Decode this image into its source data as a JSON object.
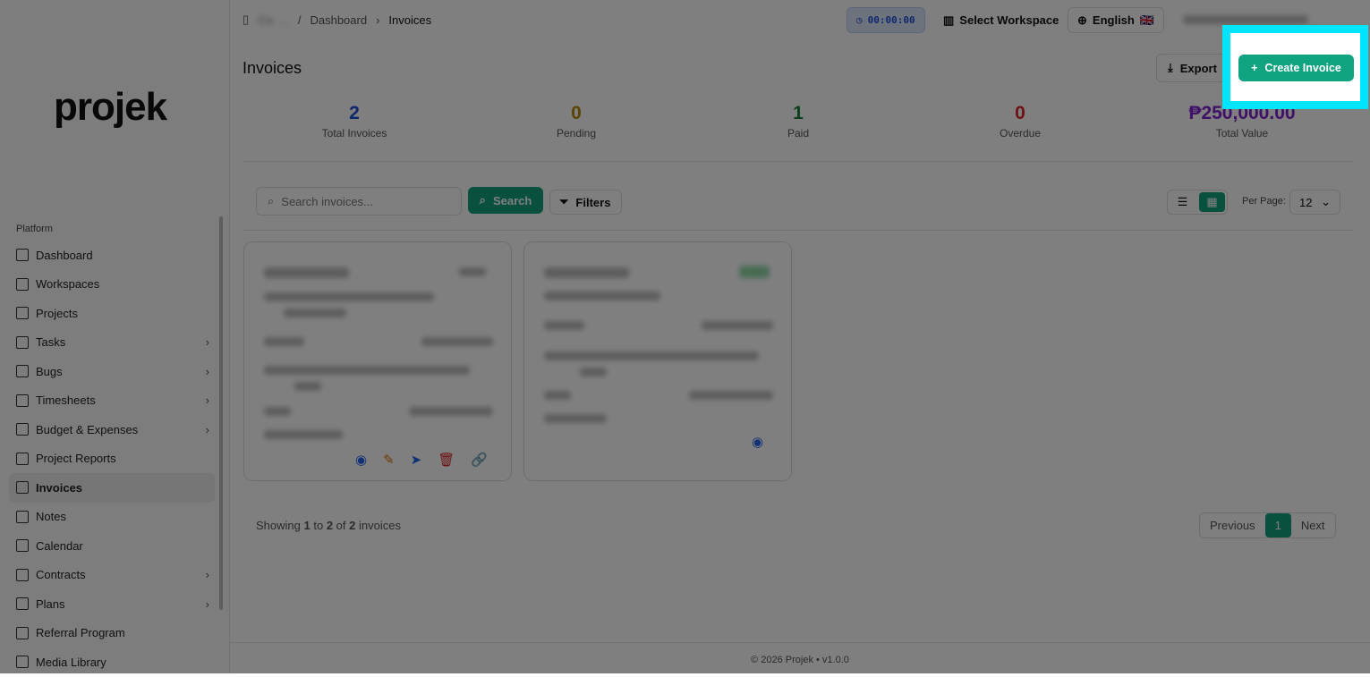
{
  "sidebar": {
    "logo": "projek",
    "section": "Platform",
    "items": [
      {
        "label": "Dashboard",
        "chev": false
      },
      {
        "label": "Workspaces",
        "chev": false
      },
      {
        "label": "Projects",
        "chev": false
      },
      {
        "label": "Tasks",
        "chev": true
      },
      {
        "label": "Bugs",
        "chev": true
      },
      {
        "label": "Timesheets",
        "chev": true
      },
      {
        "label": "Budget & Expenses",
        "chev": true
      },
      {
        "label": "Project Reports",
        "chev": false
      },
      {
        "label": "Invoices",
        "chev": false,
        "active": true
      },
      {
        "label": "Notes",
        "chev": false
      },
      {
        "label": "Calendar",
        "chev": false
      },
      {
        "label": "Contracts",
        "chev": true
      },
      {
        "label": "Plans",
        "chev": true
      },
      {
        "label": "Referral Program",
        "chev": false
      },
      {
        "label": "Media Library",
        "chev": false
      }
    ]
  },
  "topbar": {
    "workspace_blurred": "Co. ...",
    "crumb_dashboard": "Dashboard",
    "crumb_current": "Invoices",
    "timer": "00:00:00",
    "select_workspace": "Select Workspace",
    "language": "English",
    "flag": "🇬🇧"
  },
  "page": {
    "title": "Invoices",
    "export": "Export",
    "create": "Create Invoice"
  },
  "stats": [
    {
      "value": "2",
      "label": "Total Invoices",
      "color": "#1d4ed8"
    },
    {
      "value": "0",
      "label": "Pending",
      "color": "#b8860b"
    },
    {
      "value": "1",
      "label": "Paid",
      "color": "#15803d"
    },
    {
      "value": "0",
      "label": "Overdue",
      "color": "#dc2626"
    },
    {
      "value": "₱250,000.00",
      "label": "Total Value",
      "color": "#7e22ce"
    }
  ],
  "toolbar": {
    "search_placeholder": "Search invoices...",
    "search_button": "Search",
    "filters": "Filters",
    "per_page_label": "Per Page:",
    "per_page": "12"
  },
  "pagination": {
    "showing_prefix": "Showing",
    "from": "1",
    "to": "2",
    "total": "2",
    "suffix": "invoices",
    "previous": "Previous",
    "page": "1",
    "next": "Next"
  },
  "footer": "© 2026 Projek • v1.0.0"
}
